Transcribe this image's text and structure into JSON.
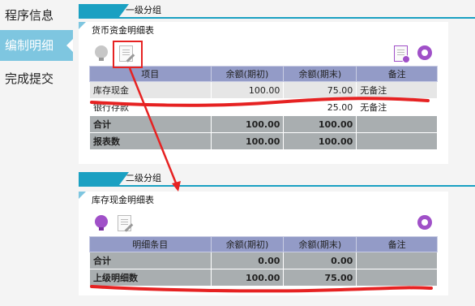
{
  "sidebar": {
    "items": [
      {
        "label": "程序信息",
        "active": false
      },
      {
        "label": "编制明细",
        "active": true
      },
      {
        "label": "完成提交",
        "active": false
      }
    ]
  },
  "group1": {
    "title": "一级分组",
    "panel_title": "货币资金明细表",
    "columns": [
      "项目",
      "余额(期初)",
      "余额(期末)",
      "备注"
    ],
    "rows": [
      {
        "item": "库存现金",
        "start": "100.00",
        "end": "75.00",
        "note": "无备注"
      },
      {
        "item": "银行存款",
        "start": "",
        "end": "25.00",
        "note": "无备注"
      }
    ],
    "totals": [
      {
        "item": "合计",
        "start": "100.00",
        "end": "100.00",
        "note": ""
      },
      {
        "item": "报表数",
        "start": "100.00",
        "end": "100.00",
        "note": ""
      }
    ]
  },
  "group2": {
    "title": "二级分组",
    "panel_title": "库存现金明细表",
    "columns": [
      "明细条目",
      "余额(期初)",
      "余额(期末)",
      "备注"
    ],
    "totals": [
      {
        "item": "合计",
        "start": "0.00",
        "end": "0.00",
        "note": ""
      },
      {
        "item": "上级明细数",
        "start": "100.00",
        "end": "75.00",
        "note": ""
      }
    ]
  },
  "colors": {
    "accent": "#1aa0c2",
    "sidebar_active": "#7ec6e0",
    "header": "#939bc7",
    "summary": "#a9aeb0",
    "annotation": "#e62222"
  },
  "icons": [
    "bulb-icon",
    "edit-document-icon",
    "document-settings-icon",
    "refresh-icon"
  ]
}
